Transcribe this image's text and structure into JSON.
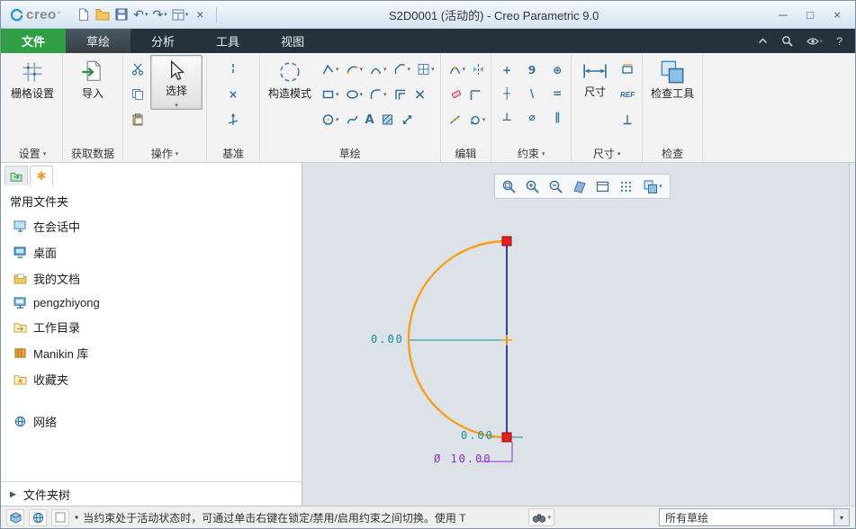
{
  "titlebar": {
    "logo": "creo",
    "title": "S2D0001 (活动的) - Creo Parametric 9.0"
  },
  "tabbar": {
    "file_tab": "文件",
    "tabs": [
      "草绘",
      "分析",
      "工具",
      "视图"
    ]
  },
  "ribbon": {
    "settings": {
      "label": "设置",
      "grid_button": "栅格设置"
    },
    "get_data": {
      "label": "获取数据",
      "import_button": "导入"
    },
    "operations": {
      "label": "操作",
      "select_button": "选择"
    },
    "datum": {
      "label": "基准"
    },
    "sketch": {
      "label": "草绘",
      "construction_button": "构造模式"
    },
    "edit": {
      "label": "编辑"
    },
    "constrain": {
      "label": "约束",
      "icons": [
        "+",
        "9",
        "⊕",
        "┼",
        "\\",
        "=",
        "⊥",
        "⌀",
        "∥"
      ]
    },
    "dimension": {
      "label": "尺寸",
      "dim_button": "尺寸",
      "ref": "REF"
    },
    "inspect": {
      "label": "检查",
      "inspect_button": "检查工具"
    }
  },
  "left_panel": {
    "header": "常用文件夹",
    "items": [
      "在会话中",
      "桌面",
      "我的文档",
      "pengzhiyong",
      "工作目录",
      "Manikin 库",
      "收藏夹"
    ],
    "network": "网络",
    "folder_tree": "文件夹树"
  },
  "sketch": {
    "dim_mid": "0.00",
    "dim_bottom": "0.00",
    "dim_diameter": "Ø 10.00"
  },
  "statusbar": {
    "message": "当约束处于活动状态时，可通过单击右键在锁定/禁用/启用约束之间切换。使用 T",
    "filter": "所有草绘"
  },
  "glyphs": {
    "caret_down": "▾",
    "tri_right": "▶",
    "asterisk": "✱",
    "minimize": "─",
    "maximize": "□",
    "close": "×",
    "undo": "↶",
    "redo": "↷",
    "help": "?",
    "bullet": "•",
    "logo_mark": "°",
    "text_tool": "A",
    "point_x": "×"
  },
  "colors": {
    "arc_orange": "#f5a11c",
    "line_navy": "#26298c",
    "endpoint_red": "#e02020",
    "dim_teal": "#12919b",
    "dim_purple": "#8b2fc9",
    "file_tab_green": "#2f9e44"
  }
}
